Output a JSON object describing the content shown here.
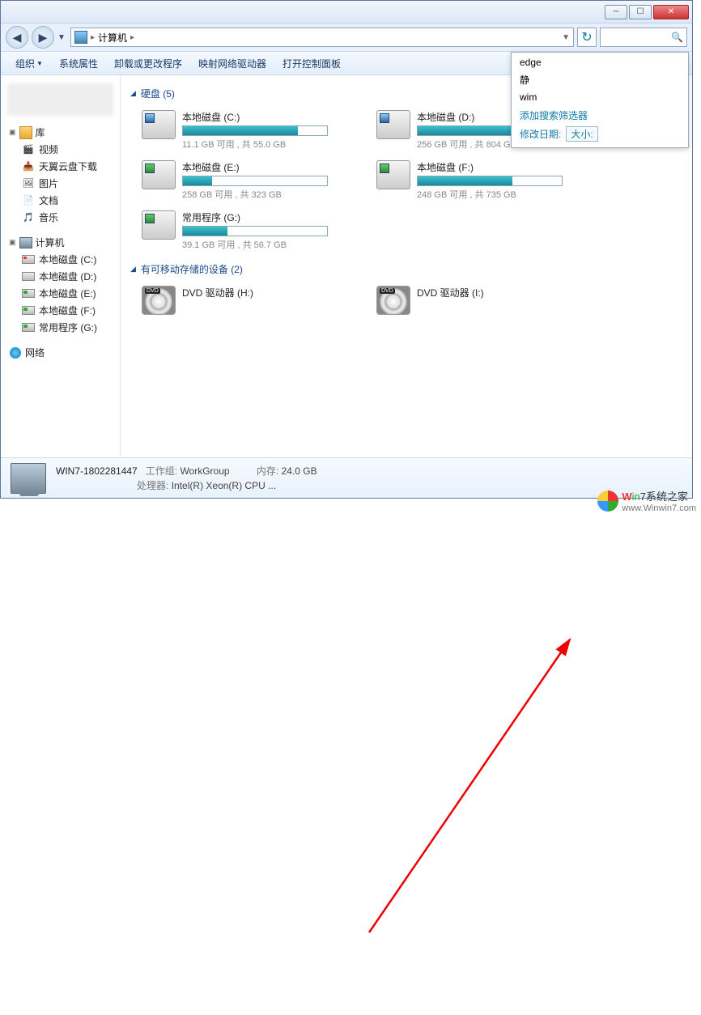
{
  "address": {
    "location": "计算机"
  },
  "toolbar": {
    "organize": "组织",
    "sysprops": "系统属性",
    "uninstall": "卸载或更改程序",
    "mapdrive": "映射网络驱动器",
    "controlpanel": "打开控制面板"
  },
  "sidebar": {
    "libraries": {
      "label": "库",
      "items": [
        {
          "label": "视频",
          "icon": "video"
        },
        {
          "label": "天翼云盘下载",
          "icon": "download"
        },
        {
          "label": "图片",
          "icon": "pictures"
        },
        {
          "label": "文档",
          "icon": "documents"
        },
        {
          "label": "音乐",
          "icon": "music"
        }
      ]
    },
    "computer": {
      "label": "计算机",
      "items": [
        {
          "label": "本地磁盘 (C:)",
          "kind": "c"
        },
        {
          "label": "本地磁盘 (D:)",
          "kind": "d"
        },
        {
          "label": "本地磁盘 (E:)",
          "kind": "g"
        },
        {
          "label": "本地磁盘 (F:)",
          "kind": "g"
        },
        {
          "label": "常用程序 (G:)",
          "kind": "g"
        }
      ]
    },
    "network": {
      "label": "网络"
    }
  },
  "groups": {
    "hdd": {
      "title": "硬盘 (5)"
    },
    "removable": {
      "title": "有可移动存储的设备 (2)"
    }
  },
  "drives": [
    {
      "label": "本地磁盘 (C:)",
      "sub": "11.1 GB 可用 , 共 55.0 GB",
      "fill": 80,
      "icon": "sys"
    },
    {
      "label": "本地磁盘 (D:)",
      "sub": "256 GB 可用 , 共 804 GB",
      "fill": 68,
      "icon": "sys"
    },
    {
      "label": "本地磁盘 (E:)",
      "sub": "258 GB 可用 , 共 323 GB",
      "fill": 20,
      "icon": "data"
    },
    {
      "label": "本地磁盘 (F:)",
      "sub": "248 GB 可用 , 共 735 GB",
      "fill": 66,
      "icon": "data"
    },
    {
      "label": "常用程序 (G:)",
      "sub": "39.1 GB 可用 , 共 56.7 GB",
      "fill": 31,
      "icon": "data"
    }
  ],
  "opticals": [
    {
      "label": "DVD 驱动器 (H:)"
    },
    {
      "label": "DVD 驱动器 (I:)"
    }
  ],
  "suggest": {
    "history": [
      "edge",
      "静",
      "wim"
    ],
    "filters_header": "添加搜索筛选器",
    "date_label": "修改日期:",
    "size_label": "大小:"
  },
  "status": {
    "name": "WIN7-1802281447",
    "workgroup_label": "工作组:",
    "workgroup": "WorkGroup",
    "cpu_label": "处理器:",
    "cpu": "Intel(R) Xeon(R) CPU ...",
    "mem_label": "内存:",
    "mem": "24.0 GB"
  },
  "watermark": {
    "brand_prefix": "W",
    "brand_mid": "in",
    "brand_suffix": "7系统之家",
    "url": "www.Winwin7.com"
  }
}
